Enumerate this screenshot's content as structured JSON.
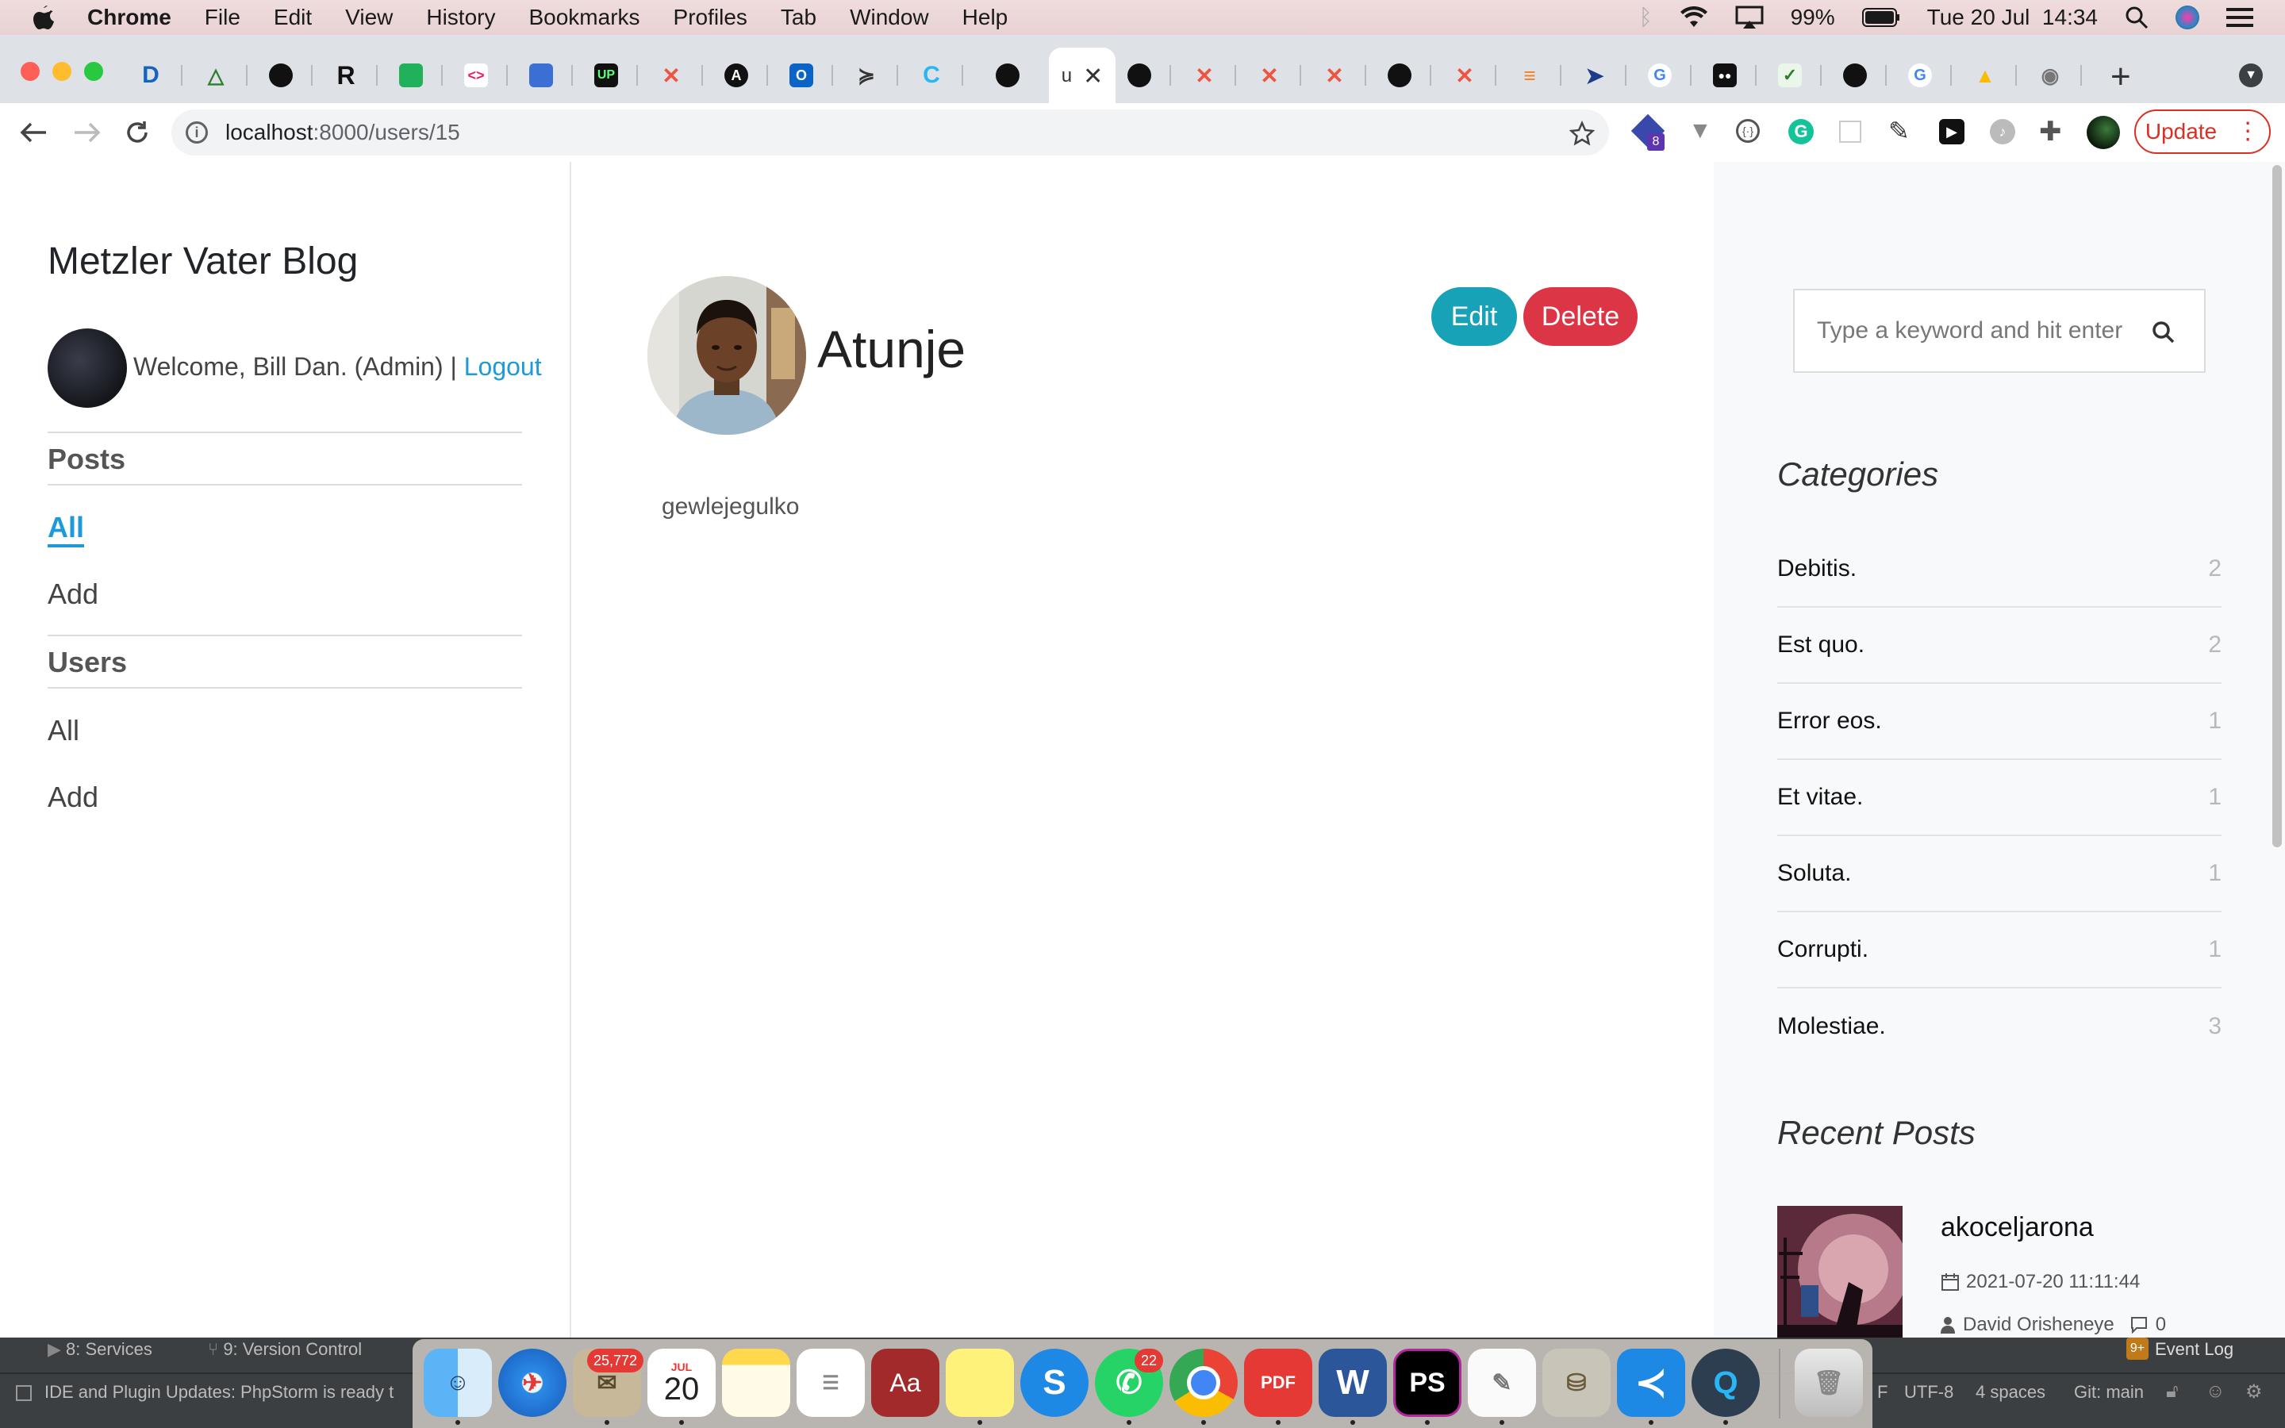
{
  "menubar": {
    "app_name": "Chrome",
    "items": [
      "File",
      "Edit",
      "View",
      "History",
      "Bookmarks",
      "Profiles",
      "Tab",
      "Window",
      "Help"
    ],
    "battery": "99%",
    "datetime": "Tue 20 Jul  14:34"
  },
  "browser": {
    "active_tab_label": "u",
    "url_host": "localhost",
    "url_rest": ":8000/users/15",
    "update_label": "Update",
    "extension_badge": "8"
  },
  "sidebar": {
    "blog_title": "Metzler Vater Blog",
    "welcome_text": "Welcome, Bill Dan. (Admin) |",
    "logout_label": "Logout",
    "posts_heading": "Posts",
    "posts_all": "All",
    "posts_add": "Add",
    "users_heading": "Users",
    "users_all": "All",
    "users_add": "Add"
  },
  "profile": {
    "name": "Atunje",
    "bio": "gewlejegulko",
    "edit_label": "Edit",
    "delete_label": "Delete"
  },
  "search": {
    "placeholder": "Type a keyword and hit enter"
  },
  "categories": {
    "heading": "Categories",
    "items": [
      {
        "name": "Debitis.",
        "count": "2"
      },
      {
        "name": "Est quo.",
        "count": "2"
      },
      {
        "name": "Error eos.",
        "count": "1"
      },
      {
        "name": "Et vitae.",
        "count": "1"
      },
      {
        "name": "Soluta.",
        "count": "1"
      },
      {
        "name": "Corrupti.",
        "count": "1"
      },
      {
        "name": "Molestiae.",
        "count": "3"
      }
    ]
  },
  "recent_posts": {
    "heading": "Recent Posts",
    "items": [
      {
        "title": "akoceljarona",
        "date": "2021-07-20 11:11:44",
        "author": "David Orisheneye",
        "comments": "0"
      }
    ]
  },
  "ide": {
    "services": "8: Services",
    "version_control": "9: Version Control",
    "update_message": "IDE and Plugin Updates: PhpStorm is ready t",
    "event_log": "Event Log",
    "event_badge": "9+",
    "encoding": "UTF-8",
    "indent": "4 spaces",
    "git_branch": "Git: main",
    "line_sep": "F"
  },
  "dock": {
    "mail_badge": "25,772",
    "calendar_month": "JUL",
    "calendar_day": "20",
    "whatsapp_badge": "22"
  },
  "colors": {
    "accent": "#1e9bd7",
    "edit": "#17a2b8",
    "delete": "#dc3545"
  }
}
